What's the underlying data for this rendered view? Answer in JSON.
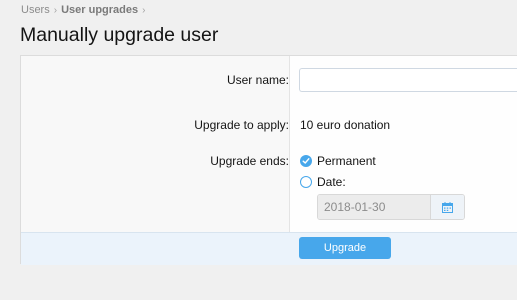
{
  "breadcrumb": {
    "items": [
      "Users",
      "User upgrades"
    ],
    "separator": "›"
  },
  "page": {
    "title": "Manually upgrade user"
  },
  "form": {
    "user_name_label": "User name:",
    "user_name_value": "",
    "upgrade_label": "Upgrade to apply:",
    "upgrade_value": "10 euro donation",
    "ends_label": "Upgrade ends:",
    "option_permanent": "Permanent",
    "option_date": "Date:",
    "selected_option": "Permanent",
    "date_value": "2018-01-30",
    "submit_label": "Upgrade"
  },
  "colors": {
    "accent": "#47a7eb",
    "footer_bg": "#ebf3fb",
    "page_bg": "#f0f0f0"
  },
  "icons": {
    "check": "checkmark-icon",
    "calendar": "calendar-icon",
    "separator": "chevron-right-icon"
  }
}
